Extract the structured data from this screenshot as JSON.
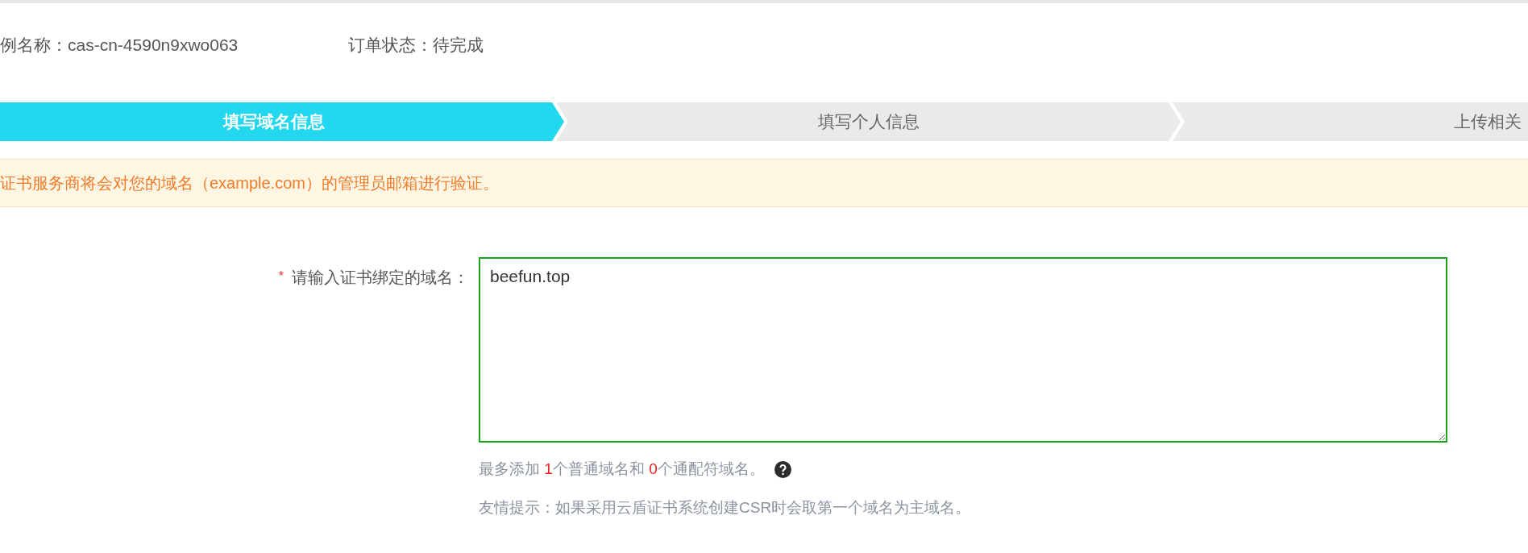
{
  "info": [
    "例名称：cas-cn-4590n9xwo063",
    "订单状态：待完成"
  ],
  "steps": [
    {
      "label": "填写域名信息",
      "selected": true
    },
    {
      "label": "填写个人信息",
      "selected": false
    },
    {
      "label": "上传相关",
      "selected": false
    }
  ],
  "alert": "证书服务商将会对您的域名（example.com）的管理员邮箱进行验证。",
  "field": {
    "required_mark": "*",
    "label": "请输入证书绑定的域名：",
    "value": "beefun.top"
  },
  "hint": [
    {
      "kind": "text",
      "text": "最多添加 "
    },
    {
      "kind": "count",
      "text": "1"
    },
    {
      "kind": "text",
      "text": "个普通域名和 "
    },
    {
      "kind": "count",
      "text": "0"
    },
    {
      "kind": "text",
      "text": "个通配符域名。"
    }
  ],
  "tip": "友情提示：如果采用云盾证书系统创建CSR时会取第一个域名为主域名。"
}
